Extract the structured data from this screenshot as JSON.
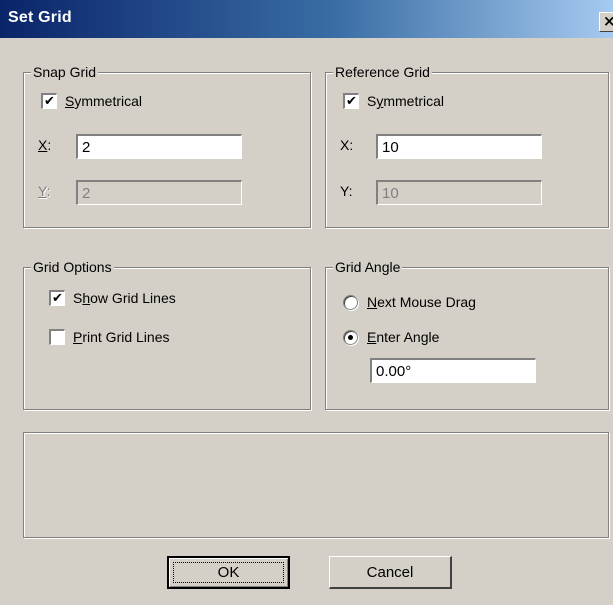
{
  "window": {
    "title": "Set Grid",
    "close_glyph": "✕"
  },
  "snap_grid": {
    "legend": "Snap Grid",
    "symmetrical": {
      "label_ul": "S",
      "label_rest": "ymmetrical",
      "checked": true
    },
    "x_label_ul": "X",
    "x_label_rest": ":",
    "x_value": "2",
    "y_label_ul": "Y",
    "y_label_rest": ":",
    "y_value": "2"
  },
  "reference_grid": {
    "legend": "Reference Grid",
    "symmetrical": {
      "label_pre": "S",
      "label_ul": "y",
      "label_rest": "mmetrical",
      "checked": true
    },
    "x_label": "X:",
    "x_value": "10",
    "y_label": "Y:",
    "y_value": "10"
  },
  "grid_options": {
    "legend": "Grid Options",
    "show_grid_lines": {
      "label_pre": "S",
      "label_ul": "h",
      "label_rest": "ow Grid Lines",
      "checked": true
    },
    "print_grid_lines": {
      "label_ul": "P",
      "label_rest": "rint Grid Lines",
      "checked": false
    }
  },
  "grid_angle": {
    "legend": "Grid Angle",
    "next_mouse_drag": {
      "label_ul": "N",
      "label_rest": "ext Mouse Drag",
      "selected": false
    },
    "enter_angle": {
      "label_ul": "E",
      "label_rest": "nter Angle",
      "selected": true
    },
    "angle_value": "0.00°"
  },
  "buttons": {
    "ok_label": "OK",
    "cancel_label": "Cancel"
  },
  "icons": {
    "check": "✔"
  }
}
